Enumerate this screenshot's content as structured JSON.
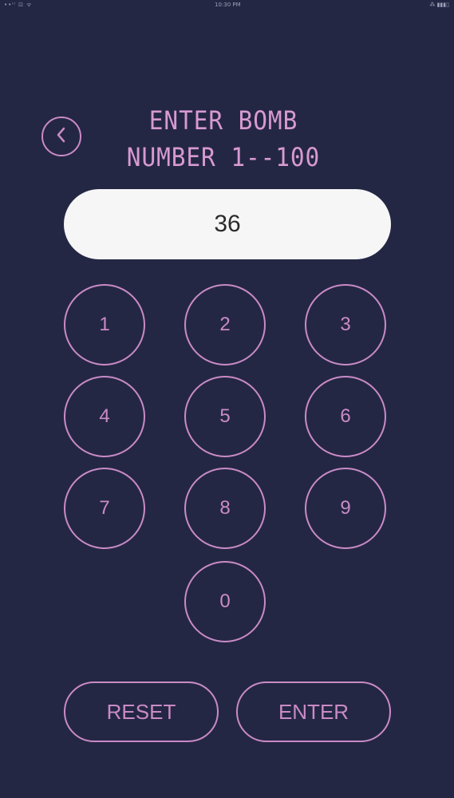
{
  "status_bar": {
    "left": "••ᴵᴵ ⊡ ᯤ",
    "time": "10:30 PM",
    "right": "⁂ ▮▮▮▯"
  },
  "header": {
    "back_icon": "chevron-left-icon",
    "title_line1": "ENTER BOMB",
    "title_line2": "NUMBER 1--100"
  },
  "display": {
    "value": "36"
  },
  "keypad": {
    "keys": [
      "1",
      "2",
      "3",
      "4",
      "5",
      "6",
      "7",
      "8",
      "9",
      "0"
    ]
  },
  "actions": {
    "reset_label": "RESET",
    "enter_label": "ENTER"
  },
  "colors": {
    "background": "#242744",
    "accent": "#c98bc6",
    "title": "#d79ad2",
    "display_bg": "#f6f6f7"
  }
}
